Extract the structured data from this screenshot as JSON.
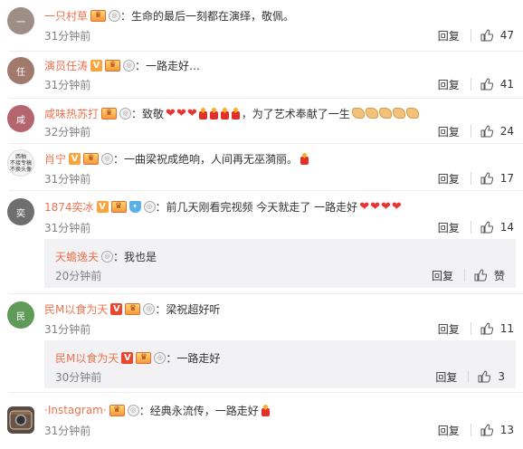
{
  "reply_label": "回复",
  "colors": {
    "username": "#eb7350",
    "text": "#333333",
    "time": "#808080",
    "heart": "#e8332f",
    "candle": "#e32f2a"
  },
  "comments": [
    {
      "username": "一只村草",
      "badges": [
        "vip",
        "ring"
      ],
      "text": "：生命的最后一刻都在演绎，敬佩。",
      "time": "31分钟前",
      "likes": "47",
      "avatar_color": "#9d8e86",
      "avatar_label": "一"
    },
    {
      "username": "演员任涛",
      "badges": [
        "v",
        "vip",
        "ring"
      ],
      "text": "：一路走好…",
      "time": "31分钟前",
      "likes": "41",
      "avatar_color": "#a1796d",
      "avatar_label": "任"
    },
    {
      "username": "咸味热苏打",
      "badges": [
        "vip",
        "ring"
      ],
      "text": "：致敬",
      "text2": "，为了艺术奉献了一生",
      "time": "32分钟前",
      "likes": "24",
      "avatar_color": "#b5656e",
      "avatar_label": "咸"
    },
    {
      "username": "肖宁",
      "badges": [
        "v",
        "vip",
        "ring"
      ],
      "text": "：一曲梁祝成绝响，人间再无巫漪丽。",
      "time": "31分钟前",
      "likes": "17",
      "avatar_color": "#f4f4f4",
      "avatar_label": "西柚\n不接专稿\n不换头像"
    },
    {
      "username": "1874奕冰",
      "badges": [
        "v",
        "vip",
        "shield",
        "ring"
      ],
      "text": "：前几天刚看完视频  今天就走了   一路走好",
      "time": "31分钟前",
      "likes": "14",
      "avatar_color": "#6f6f6f",
      "avatar_label": "奕"
    },
    {
      "username": "民M以食为天",
      "badges": [
        "v",
        "vip",
        "ring"
      ],
      "text": "：梁祝超好听",
      "time": "31分钟前",
      "likes": "11",
      "avatar_color": "#5f9a59",
      "avatar_label": "民"
    },
    {
      "username": "·Instagram·",
      "badges": [
        "vip",
        "ring"
      ],
      "text": "：经典永流传，一路走好",
      "time": "31分钟前",
      "likes": "13",
      "avatar_color": "#5a4b45",
      "avatar_label": "IG"
    }
  ],
  "replies": [
    {
      "username": "天蟾逸夫",
      "text": "：我也是",
      "time": "20分钟前",
      "likes_label": "赞"
    },
    {
      "username": "民M以食为天",
      "text": "：一路走好",
      "time": "30分钟前",
      "likes": "3"
    }
  ]
}
